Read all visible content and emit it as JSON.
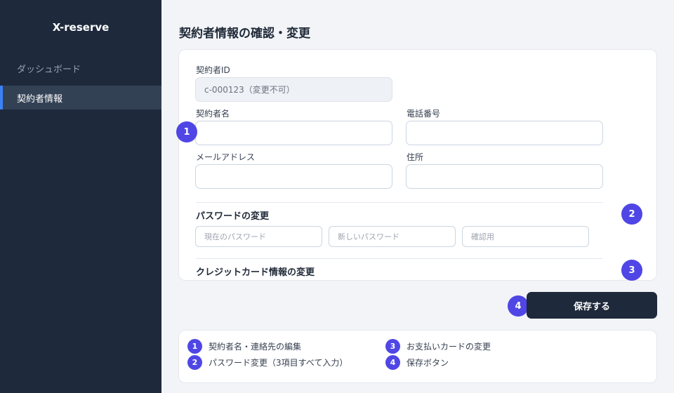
{
  "sidebar": {
    "brand": "X-reserve",
    "items": [
      {
        "label": "ダッシュボード"
      },
      {
        "label": "契約者情報"
      }
    ]
  },
  "page": {
    "title": "契約者情報の確認・変更"
  },
  "form": {
    "contract_id": {
      "label": "契約者ID",
      "value": "c-000123（変更不可）"
    },
    "name": {
      "label": "契約者名",
      "value": ""
    },
    "phone": {
      "label": "電話番号",
      "value": ""
    },
    "email": {
      "label": "メールアドレス",
      "value": ""
    },
    "address": {
      "label": "住所",
      "value": ""
    },
    "password_section": {
      "title": "パスワードの変更",
      "current_placeholder": "現在のパスワード",
      "new_placeholder": "新しいパスワード",
      "confirm_placeholder": "確認用"
    },
    "card_section": {
      "title": "クレジットカード情報の変更"
    }
  },
  "actions": {
    "save_label": "保存する"
  },
  "badges": [
    "1",
    "2",
    "3",
    "4"
  ],
  "legend": [
    {
      "num": "1",
      "text": "契約者名・連絡先の編集"
    },
    {
      "num": "2",
      "text": "パスワード変更（3項目すべて入力）"
    },
    {
      "num": "3",
      "text": "お支払いカードの変更"
    },
    {
      "num": "4",
      "text": "保存ボタン"
    }
  ],
  "colors": {
    "sidebar_bg": "#1e293b",
    "accent": "#3b82f6",
    "badge": "#4f46e5",
    "save_button": "#1e293b"
  }
}
